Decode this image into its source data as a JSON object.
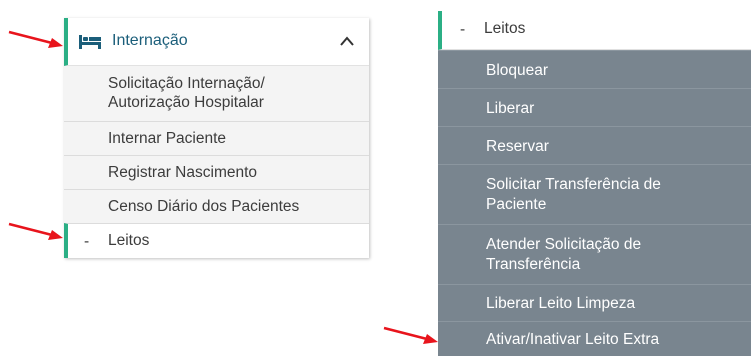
{
  "left_panel": {
    "section_title": "Internação",
    "items": [
      {
        "label_line1": "Solicitação Internação/",
        "label_line2": "Autorização Hospitalar"
      },
      {
        "label": "Internar Paciente"
      },
      {
        "label": "Registrar Nascimento"
      },
      {
        "label": "Censo Diário dos Pacientes"
      }
    ],
    "leitos": {
      "symbol": "-",
      "label": "Leitos"
    }
  },
  "right_panel": {
    "header": {
      "symbol": "-",
      "label": "Leitos"
    },
    "items": [
      {
        "label": "Bloquear"
      },
      {
        "label": "Liberar"
      },
      {
        "label": "Reservar"
      },
      {
        "label_line1": "Solicitar Transferência de",
        "label_line2": "Paciente"
      },
      {
        "label_line1": "Atender Solicitação de",
        "label_line2": "Transferência"
      },
      {
        "label": "Liberar Leito Limpeza"
      },
      {
        "label": "Ativar/Inativar Leito Extra"
      }
    ]
  },
  "colors": {
    "accent_green": "#2baf85",
    "title_blue": "#1b5e7a",
    "submenu_gray": "#79858f",
    "arrow_red": "#e8141c"
  },
  "icons": [
    "bed-icon",
    "chevron-up-icon",
    "red-arrow-icon"
  ]
}
